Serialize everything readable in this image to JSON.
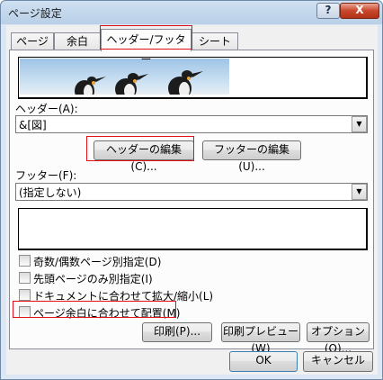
{
  "window": {
    "title": "ページ設定",
    "help": "?",
    "close": "X"
  },
  "tabs": [
    {
      "label": "ページ"
    },
    {
      "label": "余白"
    },
    {
      "label": "ヘッダー/フッター"
    },
    {
      "label": "シート"
    }
  ],
  "header": {
    "label": "ヘッダー(A):",
    "value": "&[図]",
    "edit_button": "ヘッダーの編集(C)...",
    "footer_edit_button": "フッターの編集(U)..."
  },
  "footer": {
    "label": "フッター(F):",
    "value": "(指定しない)"
  },
  "options": [
    {
      "label": "奇数/偶数ページ別指定(D)",
      "checked": false
    },
    {
      "label": "先頭ページのみ別指定(I)",
      "checked": false
    },
    {
      "label": "ドキュメントに合わせて拡大/縮小(L)",
      "checked": false
    },
    {
      "label": "ページ余白に合わせて配置(M)",
      "checked": false
    }
  ],
  "actions": {
    "print": "印刷(P)...",
    "preview": "印刷プレビュー(W)",
    "options": "オプション(O)..."
  },
  "dialog": {
    "ok": "OK",
    "cancel": "キャンセル"
  },
  "icons": {
    "arrow": "dropdown-arrow-icon"
  }
}
